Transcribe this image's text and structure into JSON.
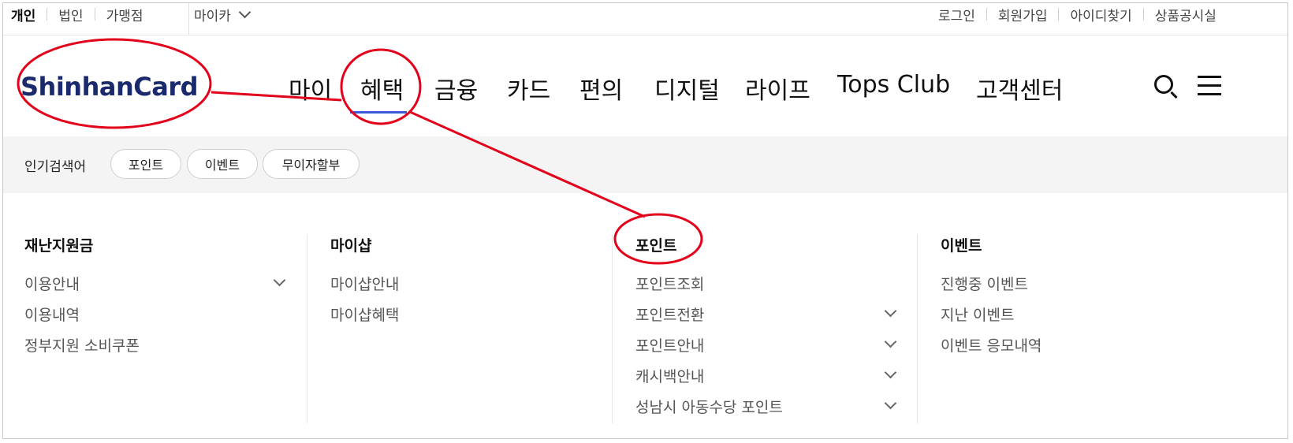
{
  "util_bar": {
    "customer_types": [
      "개인",
      "법인",
      "가맹점"
    ],
    "mycar_label": "마이카",
    "right_links": [
      "로그인",
      "회원가입",
      "아이디찾기",
      "상품공시실"
    ]
  },
  "header": {
    "logo_text": "ShinhanCard",
    "gnb": [
      "마이",
      "혜택",
      "금융",
      "카드",
      "편의",
      "디지털",
      "라이프",
      "Tops Club",
      "고객센터"
    ],
    "active_gnb": "혜택"
  },
  "popular": {
    "label": "인기검색어",
    "keywords": [
      "포인트",
      "이벤트",
      "무이자할부"
    ]
  },
  "mega_menu": {
    "columns": [
      {
        "title": "재난지원금",
        "items": [
          "이용안내",
          "이용내역",
          "정부지원 소비쿠폰"
        ]
      },
      {
        "title": "마이샵",
        "items": [
          "마이샵안내",
          "마이샵혜택"
        ]
      },
      {
        "title": "포인트",
        "items": [
          "포인트조회",
          "포인트전환",
          "포인트안내",
          "캐시백안내",
          "성남시 아동수당 포인트"
        ]
      },
      {
        "title": "이벤트",
        "items": [
          "진행중 이벤트",
          "지난 이벤트",
          "이벤트 응모내역"
        ]
      }
    ]
  },
  "colors": {
    "logo": "#1a2a6c",
    "active_underline": "#3a5bd9",
    "annotation": "#e3001b"
  }
}
